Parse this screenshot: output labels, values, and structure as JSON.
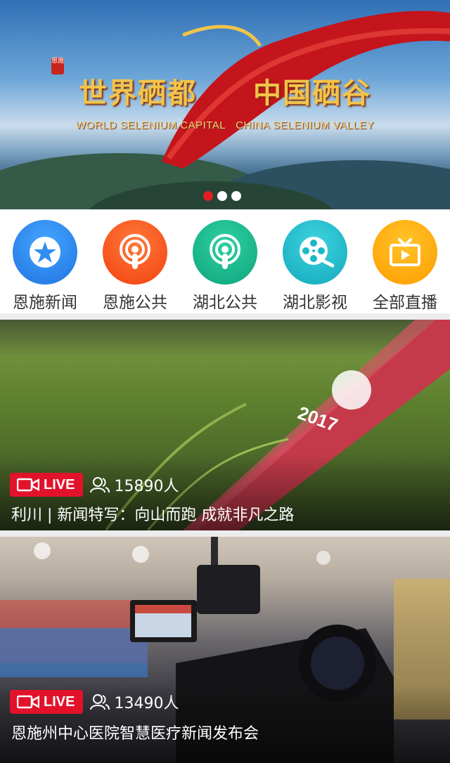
{
  "banner": {
    "title_left": "世界硒都",
    "title_right": "中国硒谷",
    "subtitle_left": "WORLD SELENIUM CAPITAL",
    "subtitle_right": "CHINA SELENIUM VALLEY",
    "seal": "恩施",
    "slide_count": 3,
    "active_slide": 1
  },
  "nav": {
    "items": [
      {
        "label": "恩施新闻",
        "icon": "star-icon",
        "color": "#2f8ef0"
      },
      {
        "label": "恩施公共",
        "icon": "podcast-icon",
        "color": "#ff5a1f"
      },
      {
        "label": "湖北公共",
        "icon": "podcast-icon",
        "color": "#12b48a"
      },
      {
        "label": "湖北影视",
        "icon": "film-reel-icon",
        "color": "#19b8c8"
      },
      {
        "label": "全部直播",
        "icon": "tv-icon",
        "color": "#ffae00"
      }
    ]
  },
  "feed": [
    {
      "live_label": "LIVE",
      "viewers": "15890人",
      "title": "利川 | 新闻特写：向山而跑 成就非凡之路",
      "ribbon_text": "2017"
    },
    {
      "live_label": "LIVE",
      "viewers": "13490人",
      "title": "恩施州中心医院智慧医疗新闻发布会"
    }
  ],
  "colors": {
    "live_red": "#e3122b",
    "active_dot": "#e02020"
  }
}
